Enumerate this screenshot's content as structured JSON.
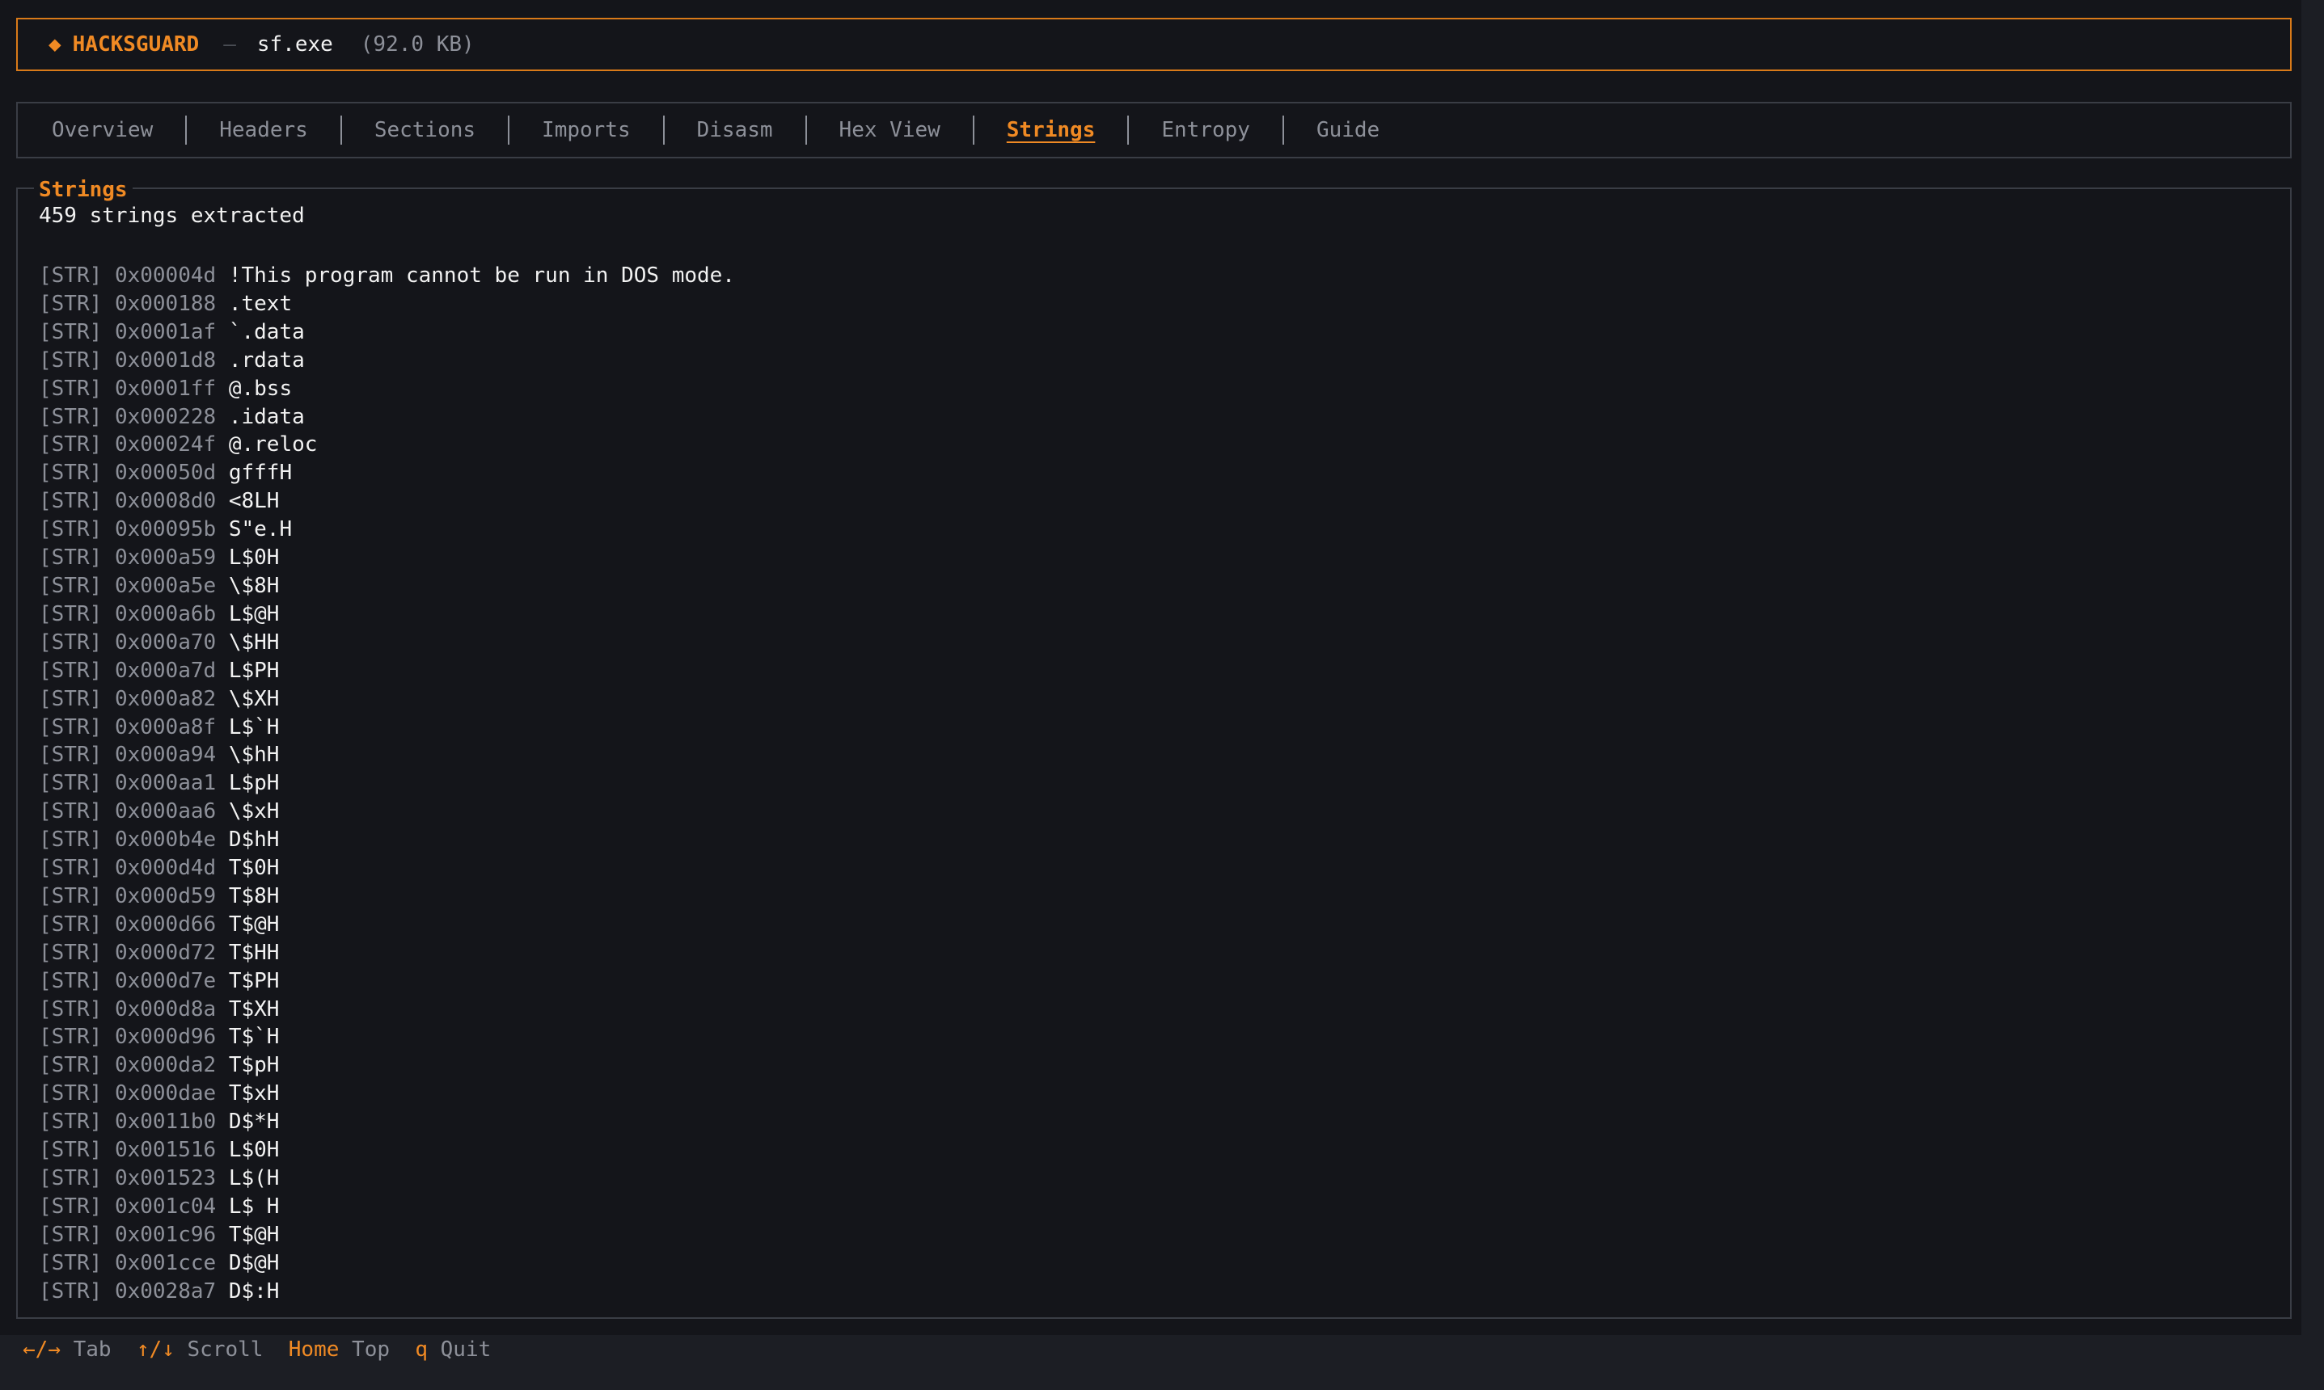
{
  "header": {
    "brand_icon": "diamond-icon",
    "brand": "HACKSGUARD",
    "separator": "—",
    "file_name": "sf.exe",
    "file_size": "(92.0 KB)"
  },
  "tabs": [
    {
      "label": "Overview"
    },
    {
      "label": "Headers"
    },
    {
      "label": "Sections"
    },
    {
      "label": "Imports"
    },
    {
      "label": "Disasm"
    },
    {
      "label": "Hex View"
    },
    {
      "label": "Strings",
      "active": true
    },
    {
      "label": "Entropy"
    },
    {
      "label": "Guide"
    }
  ],
  "strings_panel": {
    "title": "Strings",
    "summary": "459 strings extracted",
    "rows": [
      {
        "tag": "[STR]",
        "addr": "0x00004d",
        "value": "!This program cannot be run in DOS mode."
      },
      {
        "tag": "[STR]",
        "addr": "0x000188",
        "value": ".text"
      },
      {
        "tag": "[STR]",
        "addr": "0x0001af",
        "value": "`.data"
      },
      {
        "tag": "[STR]",
        "addr": "0x0001d8",
        "value": ".rdata"
      },
      {
        "tag": "[STR]",
        "addr": "0x0001ff",
        "value": "@.bss"
      },
      {
        "tag": "[STR]",
        "addr": "0x000228",
        "value": ".idata"
      },
      {
        "tag": "[STR]",
        "addr": "0x00024f",
        "value": "@.reloc"
      },
      {
        "tag": "[STR]",
        "addr": "0x00050d",
        "value": "gfffH"
      },
      {
        "tag": "[STR]",
        "addr": "0x0008d0",
        "value": "<8LH"
      },
      {
        "tag": "[STR]",
        "addr": "0x00095b",
        "value": "S\"e.H"
      },
      {
        "tag": "[STR]",
        "addr": "0x000a59",
        "value": "L$0H"
      },
      {
        "tag": "[STR]",
        "addr": "0x000a5e",
        "value": "\\$8H"
      },
      {
        "tag": "[STR]",
        "addr": "0x000a6b",
        "value": "L$@H"
      },
      {
        "tag": "[STR]",
        "addr": "0x000a70",
        "value": "\\$HH"
      },
      {
        "tag": "[STR]",
        "addr": "0x000a7d",
        "value": "L$PH"
      },
      {
        "tag": "[STR]",
        "addr": "0x000a82",
        "value": "\\$XH"
      },
      {
        "tag": "[STR]",
        "addr": "0x000a8f",
        "value": "L$`H"
      },
      {
        "tag": "[STR]",
        "addr": "0x000a94",
        "value": "\\$hH"
      },
      {
        "tag": "[STR]",
        "addr": "0x000aa1",
        "value": "L$pH"
      },
      {
        "tag": "[STR]",
        "addr": "0x000aa6",
        "value": "\\$xH"
      },
      {
        "tag": "[STR]",
        "addr": "0x000b4e",
        "value": "D$hH"
      },
      {
        "tag": "[STR]",
        "addr": "0x000d4d",
        "value": "T$0H"
      },
      {
        "tag": "[STR]",
        "addr": "0x000d59",
        "value": "T$8H"
      },
      {
        "tag": "[STR]",
        "addr": "0x000d66",
        "value": "T$@H"
      },
      {
        "tag": "[STR]",
        "addr": "0x000d72",
        "value": "T$HH"
      },
      {
        "tag": "[STR]",
        "addr": "0x000d7e",
        "value": "T$PH"
      },
      {
        "tag": "[STR]",
        "addr": "0x000d8a",
        "value": "T$XH"
      },
      {
        "tag": "[STR]",
        "addr": "0x000d96",
        "value": "T$`H"
      },
      {
        "tag": "[STR]",
        "addr": "0x000da2",
        "value": "T$pH"
      },
      {
        "tag": "[STR]",
        "addr": "0x000dae",
        "value": "T$xH"
      },
      {
        "tag": "[STR]",
        "addr": "0x0011b0",
        "value": "D$*H"
      },
      {
        "tag": "[STR]",
        "addr": "0x001516",
        "value": "L$0H"
      },
      {
        "tag": "[STR]",
        "addr": "0x001523",
        "value": "L$(H"
      },
      {
        "tag": "[STR]",
        "addr": "0x001c04",
        "value": "L$ H"
      },
      {
        "tag": "[STR]",
        "addr": "0x001c96",
        "value": "T$@H"
      },
      {
        "tag": "[STR]",
        "addr": "0x001cce",
        "value": "D$@H"
      },
      {
        "tag": "[STR]",
        "addr": "0x0028a7",
        "value": "D$:H"
      }
    ]
  },
  "footer": [
    {
      "key": "←/→",
      "label": "Tab"
    },
    {
      "key": "↑/↓",
      "label": "Scroll"
    },
    {
      "key": "Home",
      "label": "Top"
    },
    {
      "key": "q",
      "label": "Quit"
    }
  ],
  "colors": {
    "accent": "#f08a24",
    "background": "#14151a",
    "border": "#3a3d45",
    "muted": "#8d9099",
    "text": "#f2f2f2"
  }
}
